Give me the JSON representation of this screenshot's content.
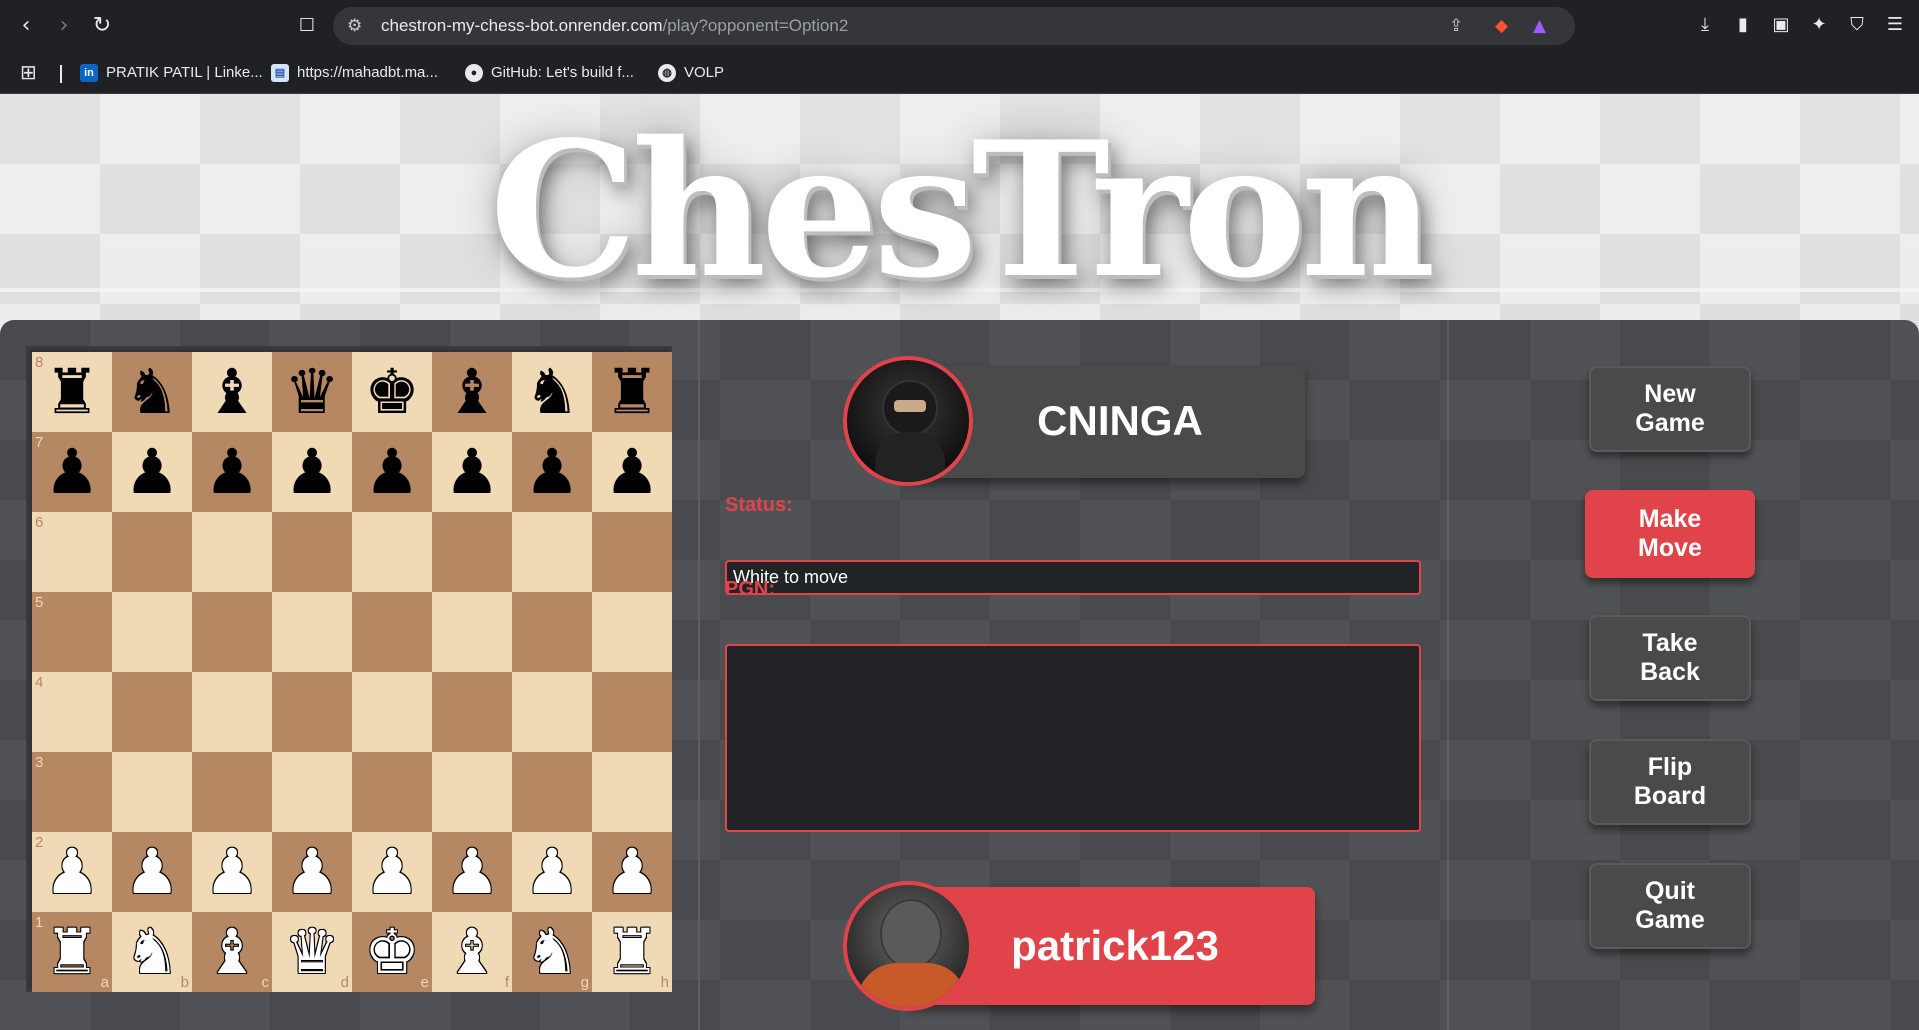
{
  "browser": {
    "url_host": "chestron-my-chess-bot.onrender.com",
    "url_path": "/play?opponent=Option2",
    "bookmarks": [
      {
        "label": "PRATIK PATIL | Linke...",
        "icon": "linkedin-icon"
      },
      {
        "label": "https://mahadbt.ma...",
        "icon": "page-icon"
      },
      {
        "label": "GitHub: Let's build f...",
        "icon": "github-icon"
      },
      {
        "label": "VOLP",
        "icon": "globe-icon"
      }
    ]
  },
  "header": {
    "title": "ChesTron"
  },
  "board": {
    "ranks": [
      "8",
      "7",
      "6",
      "5",
      "4",
      "3",
      "2",
      "1"
    ],
    "files": [
      "a",
      "b",
      "c",
      "d",
      "e",
      "f",
      "g",
      "h"
    ],
    "position": [
      [
        "bR",
        "bN",
        "bB",
        "bQ",
        "bK",
        "bB",
        "bN",
        "bR"
      ],
      [
        "bP",
        "bP",
        "bP",
        "bP",
        "bP",
        "bP",
        "bP",
        "bP"
      ],
      [
        "",
        "",
        "",
        "",
        "",
        "",
        "",
        ""
      ],
      [
        "",
        "",
        "",
        "",
        "",
        "",
        "",
        ""
      ],
      [
        "",
        "",
        "",
        "",
        "",
        "",
        "",
        ""
      ],
      [
        "",
        "",
        "",
        "",
        "",
        "",
        "",
        ""
      ],
      [
        "wP",
        "wP",
        "wP",
        "wP",
        "wP",
        "wP",
        "wP",
        "wP"
      ],
      [
        "wR",
        "wN",
        "wB",
        "wQ",
        "wK",
        "wB",
        "wN",
        "wR"
      ]
    ]
  },
  "players": {
    "opponent": {
      "name": "CNINGA"
    },
    "me": {
      "name": "patrick123"
    }
  },
  "game": {
    "status_label": "Status:",
    "status_value": "White to move",
    "pgn_label": "PGN:",
    "pgn_value": ""
  },
  "controls": {
    "new_game": "New Game",
    "make_move": "Make Move",
    "take_back": "Take Back",
    "flip_board": "Flip Board",
    "quit_game": "Quit Game"
  },
  "colors": {
    "accent": "#e0434a",
    "panel": "#4b4c50",
    "light_square": "#f0d9b5",
    "dark_square": "#b58863"
  }
}
